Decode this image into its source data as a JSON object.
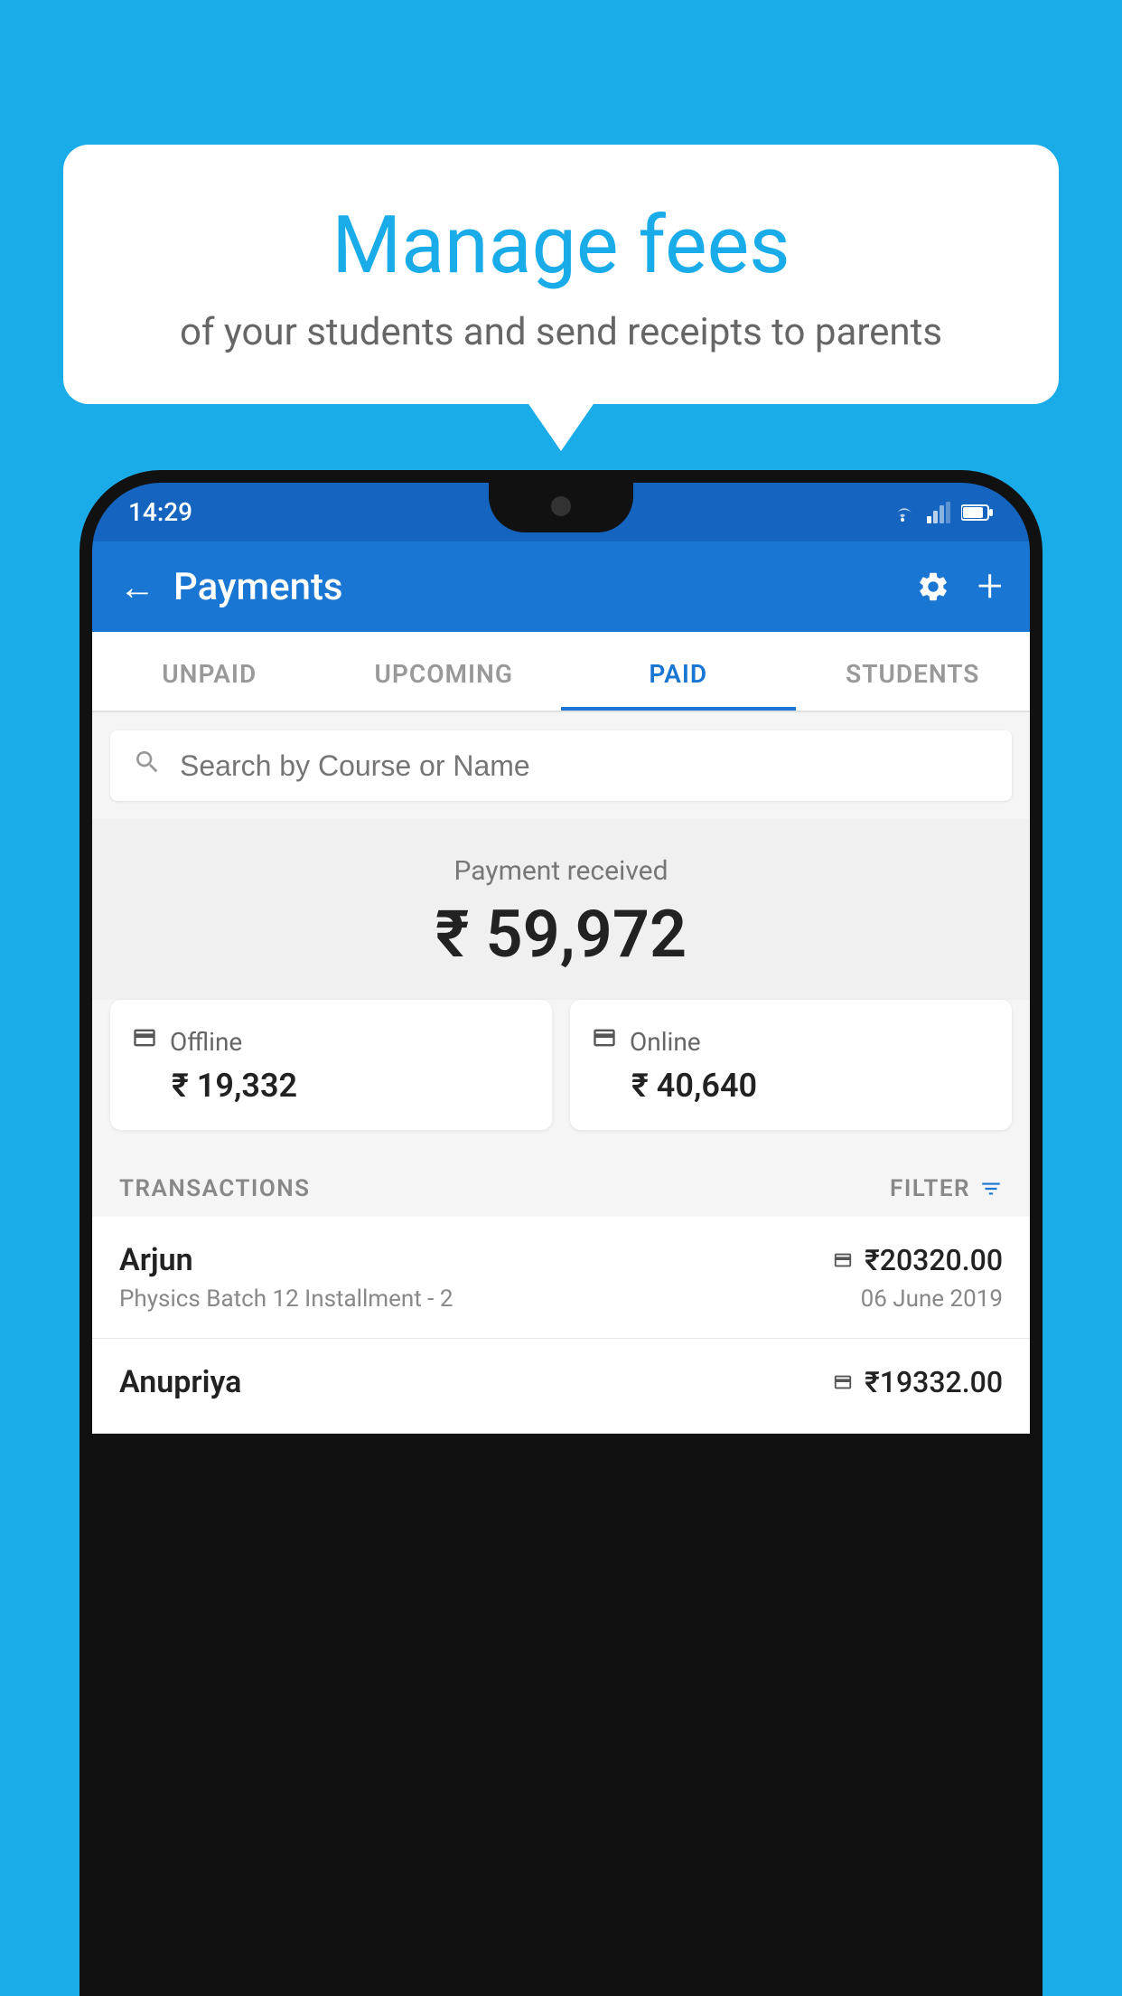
{
  "page": {
    "background_color": "#1AACE8"
  },
  "speech_bubble": {
    "title": "Manage fees",
    "subtitle": "of your students and send receipts to parents"
  },
  "status_bar": {
    "time": "14:29"
  },
  "app_bar": {
    "title": "Payments",
    "back_icon": "←",
    "settings_label": "settings",
    "add_label": "add"
  },
  "tabs": [
    {
      "label": "UNPAID",
      "active": false
    },
    {
      "label": "UPCOMING",
      "active": false
    },
    {
      "label": "PAID",
      "active": true
    },
    {
      "label": "STUDENTS",
      "active": false
    }
  ],
  "search": {
    "placeholder": "Search by Course or Name"
  },
  "payment_summary": {
    "label": "Payment received",
    "amount": "₹ 59,972",
    "offline": {
      "label": "Offline",
      "amount": "₹ 19,332"
    },
    "online": {
      "label": "Online",
      "amount": "₹ 40,640"
    }
  },
  "transactions_section": {
    "header": "TRANSACTIONS",
    "filter": "FILTER"
  },
  "transactions": [
    {
      "name": "Arjun",
      "course": "Physics Batch 12 Installment - 2",
      "amount": "₹20320.00",
      "date": "06 June 2019",
      "payment_type": "online"
    },
    {
      "name": "Anupriya",
      "course": "",
      "amount": "₹19332.00",
      "date": "",
      "payment_type": "offline"
    }
  ]
}
